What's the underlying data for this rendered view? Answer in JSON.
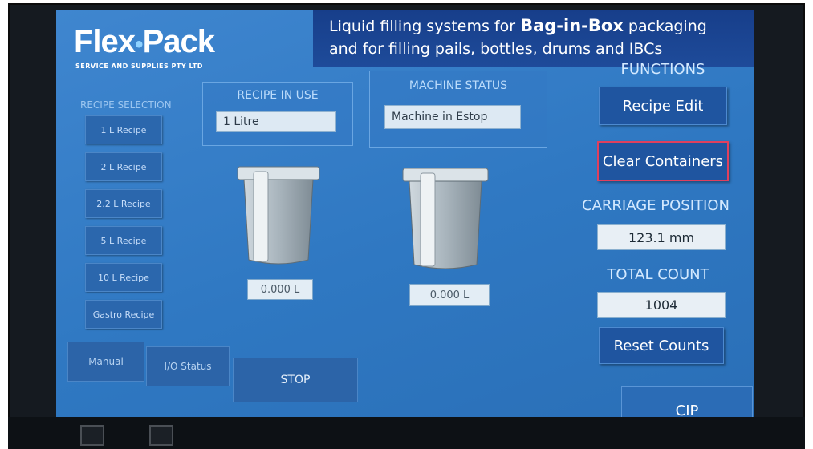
{
  "brand": {
    "name": "Flex",
    "name2": "Pack",
    "subtitle": "SERVICE AND SUPPLIES PTY LTD"
  },
  "header": {
    "line1_pre": "Liquid filling systems for ",
    "line1_bold": "Bag-in-Box",
    "line1_post": " packaging",
    "line2": "and for filling pails, bottles, drums and IBCs"
  },
  "recipe_selection": {
    "title": "RECIPE SELECTION",
    "buttons": [
      "1 L Recipe",
      "2 L Recipe",
      "2.2 L Recipe",
      "5 L Recipe",
      "10 L Recipe",
      "Gastro Recipe"
    ]
  },
  "recipe_in_use": {
    "title": "RECIPE IN USE",
    "value": "1 Litre"
  },
  "machine_status": {
    "title": "MACHINE STATUS",
    "value": "Machine in Estop"
  },
  "containers": [
    {
      "volume": "0.000 L"
    },
    {
      "volume": "0.000 L"
    }
  ],
  "functions": {
    "title": "FUNCTIONS",
    "recipe_edit": "Recipe Edit",
    "clear_containers": "Clear Containers",
    "carriage_position_label": "CARRIAGE POSITION",
    "carriage_position_value": "123.1 mm",
    "total_count_label": "TOTAL COUNT",
    "total_count_value": "1004",
    "reset_counts": "Reset Counts"
  },
  "bottom_tabs": {
    "manual": "Manual",
    "io_status": "I/O Status",
    "stop": "STOP",
    "cip": "CIP"
  },
  "colors": {
    "screen": "#2f78c2",
    "header": "#173e8a",
    "alert_border": "#e0405e"
  }
}
